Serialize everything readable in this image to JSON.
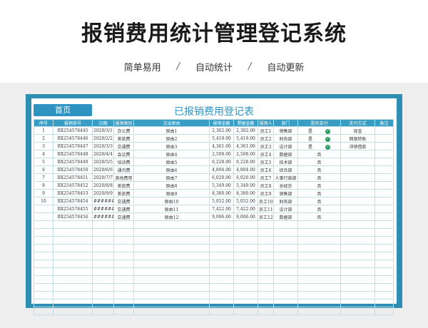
{
  "hero": {
    "title": "报销费用统计管理登记系统",
    "features": [
      "简单易用",
      "自动统计",
      "自动更新"
    ],
    "separator": "/"
  },
  "sheet": {
    "home_button": "首页",
    "title": "已报销费用登记表",
    "columns": [
      "序号",
      "报销单号",
      "日期",
      "报销类别",
      "文出原由",
      "报销金额",
      "票据金额",
      "报销人",
      "部门",
      "是否支付",
      "支付方式",
      "备注"
    ],
    "rows": [
      {
        "no": "1",
        "id": "BX254578445",
        "date": "2020/3/1",
        "cat": "办公费",
        "reason": "原由1",
        "amt": "2,302.00",
        "bill": "2,302.00",
        "person": "员工1",
        "dept": "销售部",
        "paid": "是",
        "check": true,
        "method": "现金",
        "note": ""
      },
      {
        "no": "2",
        "id": "BX254578446",
        "date": "2020/2/2",
        "cat": "差旅费",
        "reason": "原由2",
        "amt": "5,419.00",
        "bill": "5,419.00",
        "person": "员工2",
        "dept": "财务部",
        "paid": "是",
        "check": true,
        "method": "网银转账",
        "note": ""
      },
      {
        "no": "3",
        "id": "BX254578447",
        "date": "2020/3/3",
        "cat": "交通费",
        "reason": "原由3",
        "amt": "4,361.00",
        "bill": "4,361.00",
        "person": "员工3",
        "dept": "设计部",
        "paid": "是",
        "check": true,
        "method": "冲销借款",
        "note": ""
      },
      {
        "no": "4",
        "id": "BX254578448",
        "date": "2020/4/4",
        "cat": "会议费",
        "reason": "原由4",
        "amt": "2,508.00",
        "bill": "2,508.00",
        "person": "员工4",
        "dept": "数据部",
        "paid": "否",
        "check": false,
        "method": "",
        "note": ""
      },
      {
        "no": "5",
        "id": "BX254578449",
        "date": "2020/5/5",
        "cat": "培训费",
        "reason": "原由5",
        "amt": "6,228.00",
        "bill": "6,228.00",
        "person": "员工5",
        "dept": "技术部",
        "paid": "否",
        "check": false,
        "method": "",
        "note": ""
      },
      {
        "no": "6",
        "id": "BX254578450",
        "date": "2020/6/6",
        "cat": "通讯费",
        "reason": "原由6",
        "amt": "4,804.00",
        "bill": "4,804.00",
        "person": "员工6",
        "dept": "综合部",
        "paid": "否",
        "check": false,
        "method": "",
        "note": ""
      },
      {
        "no": "7",
        "id": "BX254578451",
        "date": "2020/7/7",
        "cat": "其他费用",
        "reason": "原由7",
        "amt": "6,020.00",
        "bill": "6,020.00",
        "person": "员工7",
        "dept": "人事行政部",
        "paid": "否",
        "check": false,
        "method": "",
        "note": ""
      },
      {
        "no": "8",
        "id": "BX254578452",
        "date": "2020/8/8",
        "cat": "差旅费",
        "reason": "原由8",
        "amt": "5,349.00",
        "bill": "5,349.00",
        "person": "员工8",
        "dept": "总经办",
        "paid": "否",
        "check": false,
        "method": "",
        "note": ""
      },
      {
        "no": "9",
        "id": "BX254578453",
        "date": "2020/9/9",
        "cat": "差旅费",
        "reason": "原由9",
        "amt": "8,380.00",
        "bill": "8,380.00",
        "person": "员工9",
        "dept": "销售部",
        "paid": "否",
        "check": false,
        "method": "",
        "note": ""
      },
      {
        "no": "10",
        "id": "BX254578454",
        "date": "#########",
        "cat": "交通费",
        "reason": "原由10",
        "amt": "5,052.00",
        "bill": "5,052.00",
        "person": "员工10",
        "dept": "财务部",
        "paid": "否",
        "check": false,
        "method": "",
        "note": ""
      },
      {
        "no": "",
        "id": "BX254578455",
        "date": "#########",
        "cat": "交通费",
        "reason": "原由11",
        "amt": "7,422.00",
        "bill": "7,422.00",
        "person": "员工11",
        "dept": "设计部",
        "paid": "否",
        "check": false,
        "method": "",
        "note": ""
      },
      {
        "no": "",
        "id": "BX254578456",
        "date": "#########",
        "cat": "交通费",
        "reason": "原由12",
        "amt": "9,006.00",
        "bill": "9,006.00",
        "person": "员工12",
        "dept": "数据部",
        "paid": "否",
        "check": false,
        "method": "",
        "note": ""
      }
    ],
    "check_glyph": "✓"
  }
}
